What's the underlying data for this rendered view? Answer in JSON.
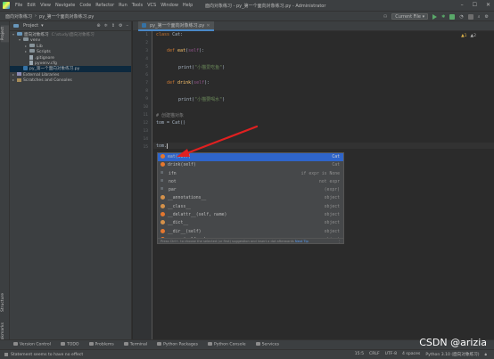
{
  "titlebar": {
    "menu": [
      "File",
      "Edit",
      "View",
      "Navigate",
      "Code",
      "Refactor",
      "Run",
      "Tools",
      "VCS",
      "Window",
      "Help"
    ],
    "title": "面向对象练习 - py_第一个面向对象练习.py - Administrator"
  },
  "navbar": {
    "breadcrumb": [
      "面向对象练习",
      "py_第一个面向对象练习.py"
    ],
    "run_config": "Current File"
  },
  "left_strip": {
    "project_tab": "Project",
    "structure_tab": "Structure",
    "bookmarks_tab": "Bookmarks"
  },
  "project": {
    "header": "Project",
    "tree": [
      {
        "label": "面向对象练习",
        "hint": "C:\\study\\面向对象练习",
        "indent": 0,
        "kind": "folder",
        "expanded": true
      },
      {
        "label": "venv",
        "hint": "",
        "indent": 1,
        "kind": "folder",
        "expanded": true
      },
      {
        "label": "Lib",
        "hint": "",
        "indent": 2,
        "kind": "folder",
        "expanded": false
      },
      {
        "label": "Scripts",
        "hint": "",
        "indent": 2,
        "kind": "folder",
        "expanded": false
      },
      {
        "label": ".gitignore",
        "hint": "",
        "indent": 2,
        "kind": "file"
      },
      {
        "label": "pyvenv.cfg",
        "hint": "",
        "indent": 2,
        "kind": "file"
      },
      {
        "label": "py_第一个面向对象练习.py",
        "hint": "",
        "indent": 1,
        "kind": "py",
        "selected": true
      },
      {
        "label": "External Libraries",
        "hint": "",
        "indent": 0,
        "kind": "lib",
        "expanded": false
      },
      {
        "label": "Scratches and Consoles",
        "hint": "",
        "indent": 0,
        "kind": "scratch",
        "expanded": false
      }
    ]
  },
  "editor": {
    "tab_label": "py_第一个面向对象练习.py",
    "inspection": {
      "warnings": "▲1",
      "weak": "▲2"
    },
    "line_numbers": [
      "1",
      "2",
      "3",
      "4",
      "5",
      "6",
      "7",
      "8",
      "9",
      "10",
      "11",
      "12",
      "13",
      "14",
      "15"
    ],
    "code": {
      "l1_kw": "class",
      "l1_rest": " Cat:",
      "l3_kw": "def",
      "l3_fn": "eat",
      "l3_open": "(",
      "l3_self": "self",
      "l3_close": "):",
      "l5_call": "print(",
      "l5_str": "\"小猫爱吃鱼\"",
      "l5_end": ")",
      "l7_kw": "def",
      "l7_fn": "drink",
      "l7_open": "(",
      "l7_self": "self",
      "l7_close": "):",
      "l9_call": "print(",
      "l9_str": "\"小猫要喝水\"",
      "l9_end": ")",
      "l11_cmt": "# 创建猫对象",
      "l12": "tom = Cat()",
      "l15": "tom."
    }
  },
  "completion": {
    "items": [
      {
        "name": "eat(self)",
        "type": "Cat",
        "icon": "method"
      },
      {
        "name": "drink(self)",
        "type": "Cat",
        "icon": "method"
      },
      {
        "name": "ifn",
        "type": "if expr is None",
        "icon": "keyword"
      },
      {
        "name": "not",
        "type": "not expr",
        "icon": "keyword"
      },
      {
        "name": "par",
        "type": "(expr)",
        "icon": "keyword"
      },
      {
        "name": "__annotations__",
        "type": "object",
        "icon": "field"
      },
      {
        "name": "__class__",
        "type": "object",
        "icon": "field"
      },
      {
        "name": "__delattr__(self, name)",
        "type": "object",
        "icon": "method"
      },
      {
        "name": "__dict__",
        "type": "object",
        "icon": "field"
      },
      {
        "name": "__dir__(self)",
        "type": "object",
        "icon": "method"
      },
      {
        "name": "__eq__(self, o)",
        "type": "object",
        "icon": "method"
      }
    ],
    "footer": "Press Ctrl+. to choose the selected (or first) suggestion and insert a dot afterwards",
    "footer_link": "Next Tip"
  },
  "bottom_tools": [
    "Version Control",
    "TODO",
    "Problems",
    "Terminal",
    "Python Packages",
    "Python Console",
    "Services"
  ],
  "status": {
    "message": "Statement seems to have no effect",
    "position": "15:5",
    "line_sep": "CRLF",
    "encoding": "UTF-8",
    "indent": "4 spaces",
    "interpreter": "Python 3.10 (面向对象练习)"
  },
  "watermark": "CSDN @arizia",
  "colors": {
    "accent": "#2f65ca",
    "arrow": "#e02020",
    "background": "#2b2b2b"
  }
}
